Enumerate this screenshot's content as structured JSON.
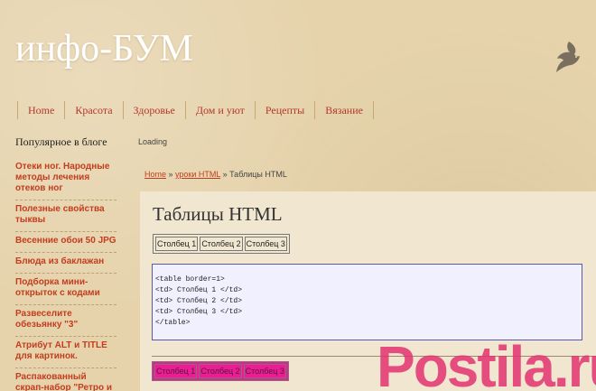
{
  "header": {
    "site_title": "инфо-БУМ"
  },
  "nav": {
    "items": [
      "Home",
      "Красота",
      "Здоровье",
      "Дом и уют",
      "Рецепты",
      "Вязание"
    ]
  },
  "sidebar": {
    "heading": "Популярное в блоге",
    "links": [
      "Отеки ног. Народные методы лечения отеков ног",
      "Полезные свойства тыквы",
      "Весенние обои 50 JPG",
      "Блюда из баклажан",
      "Подборка мини-открыток с кодами",
      "Развеселите обезьянку \"3\"",
      "Атрибут ALT и TITLE для картинок.",
      "Распакованный скрап-набор \"Ретро и винтаж\""
    ]
  },
  "loading_text": "Loading",
  "breadcrumb": {
    "home": "Home",
    "sep1": " » ",
    "section": "уроки HTML",
    "sep2": " » ",
    "current": "Таблицы HTML"
  },
  "main": {
    "title": "Таблицы HTML",
    "example_table": [
      "Столбец 1",
      "Столбец 2",
      "Столбец 3"
    ],
    "code_lines": [
      "<table border=1>",
      "<td> Столбец 1 </td>",
      "<td> Столбец 2 </td>",
      "<td> Столбец 3 </td>",
      "</table>"
    ],
    "pink_table": [
      "Столбец 1",
      "Столбец 2",
      "Столбец 3"
    ]
  },
  "watermark": {
    "text": "Postila.ru"
  },
  "colors": {
    "background": "#e6d3ac",
    "link_red": "#c33d1e",
    "nav_red": "#b3382c",
    "pink_table": "#ea1d92",
    "code_bg": "#f1f0ff",
    "code_border": "#5959a8",
    "watermark": "#e2316f"
  }
}
